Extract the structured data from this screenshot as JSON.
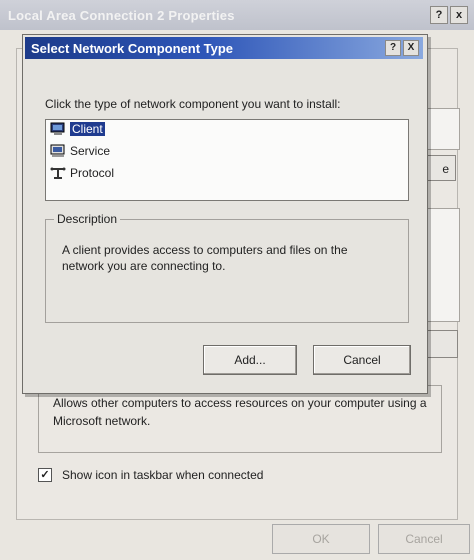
{
  "parent_window": {
    "title": "Local Area Connection 2 Properties",
    "help_glyph": "?",
    "close_glyph": "x",
    "side_button_label": "e",
    "description": "Allows other computers to access resources on your computer using a Microsoft network.",
    "show_icon_label": "Show icon in taskbar when connected",
    "show_icon_checked": true,
    "ok_label": "OK",
    "cancel_label": "Cancel"
  },
  "dialog": {
    "title": "Select Network Component Type",
    "help_glyph": "?",
    "close_glyph": "X",
    "prompt": "Click the type of network component you want to install:",
    "items": [
      {
        "label": "Client",
        "icon": "client-computer-icon",
        "selected": true
      },
      {
        "label": "Service",
        "icon": "service-computer-icon",
        "selected": false
      },
      {
        "label": "Protocol",
        "icon": "protocol-network-icon",
        "selected": false
      }
    ],
    "description_label": "Description",
    "description_text": "A client provides access to computers and files on the network you are connecting to.",
    "add_label": "Add...",
    "cancel_label": "Cancel"
  },
  "colors": {
    "title_active": "#1d3b8a",
    "selection": "#1f3b8f"
  }
}
